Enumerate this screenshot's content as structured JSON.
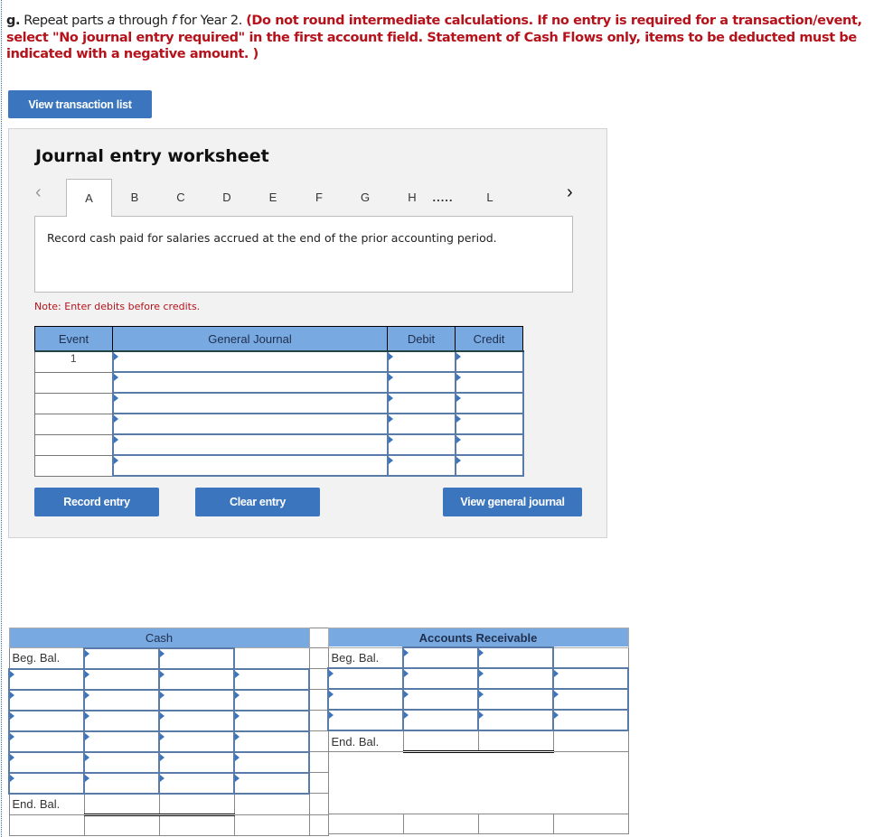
{
  "instructions": {
    "part_label": "g.",
    "text_before_a": " Repeat parts ",
    "a": "a",
    "through": " through ",
    "f": "f",
    "text_after": " for Year 2. ",
    "red_text": "(Do not round intermediate calculations. If no entry is required for a transaction/event, select \"No journal entry required\" in the first account field. Statement of Cash Flows only, items to be deducted must be indicated with a negative amount. )"
  },
  "buttons": {
    "view_transaction_list": "View transaction list",
    "record_entry": "Record entry",
    "clear_entry": "Clear entry",
    "view_general_journal": "View general journal"
  },
  "worksheet": {
    "title": "Journal entry worksheet",
    "tabs": [
      "A",
      "B",
      "C",
      "D",
      "E",
      "F",
      "G",
      "H",
      "L"
    ],
    "ellipsis": ".....",
    "active_tab": "A",
    "prev_icon": "‹",
    "next_icon": "›",
    "description": "Record cash paid for salaries accrued at the end of the prior accounting period.",
    "note": "Note: Enter debits before credits.",
    "columns": [
      "Event",
      "General Journal",
      "Debit",
      "Credit"
    ],
    "rows": [
      {
        "event": "1",
        "account": "",
        "debit": "",
        "credit": ""
      },
      {
        "event": "",
        "account": "",
        "debit": "",
        "credit": ""
      },
      {
        "event": "",
        "account": "",
        "debit": "",
        "credit": ""
      },
      {
        "event": "",
        "account": "",
        "debit": "",
        "credit": ""
      },
      {
        "event": "",
        "account": "",
        "debit": "",
        "credit": ""
      },
      {
        "event": "",
        "account": "",
        "debit": "",
        "credit": ""
      }
    ]
  },
  "t_accounts": {
    "cash": {
      "title": "Cash",
      "beg_label": "Beg. Bal.",
      "end_label": "End. Bal."
    },
    "accounts_receivable": {
      "title": "Accounts Receivable",
      "beg_label": "Beg. Bal.",
      "end_label": "End. Bal."
    }
  }
}
